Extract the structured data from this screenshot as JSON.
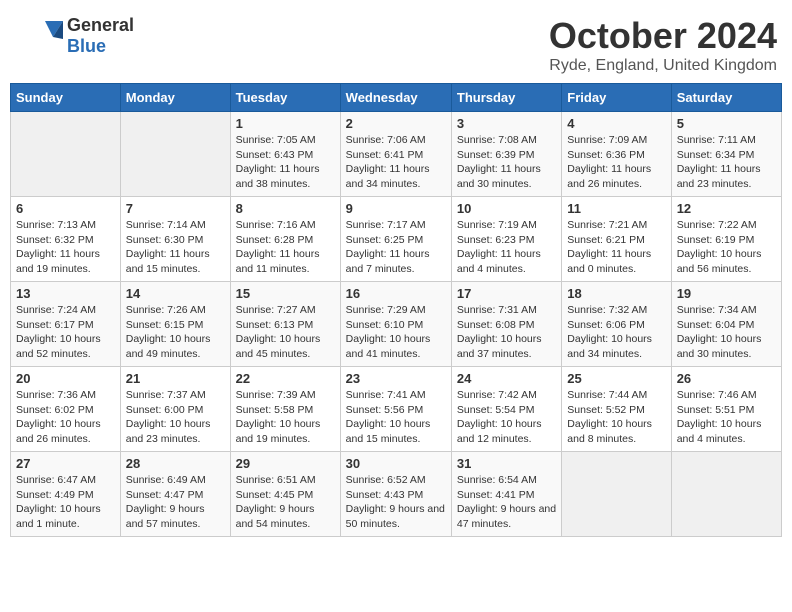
{
  "header": {
    "logo_general": "General",
    "logo_blue": "Blue",
    "month": "October 2024",
    "location": "Ryde, England, United Kingdom"
  },
  "days_of_week": [
    "Sunday",
    "Monday",
    "Tuesday",
    "Wednesday",
    "Thursday",
    "Friday",
    "Saturday"
  ],
  "weeks": [
    [
      {
        "day": "",
        "info": ""
      },
      {
        "day": "",
        "info": ""
      },
      {
        "day": "1",
        "info": "Sunrise: 7:05 AM\nSunset: 6:43 PM\nDaylight: 11 hours and 38 minutes."
      },
      {
        "day": "2",
        "info": "Sunrise: 7:06 AM\nSunset: 6:41 PM\nDaylight: 11 hours and 34 minutes."
      },
      {
        "day": "3",
        "info": "Sunrise: 7:08 AM\nSunset: 6:39 PM\nDaylight: 11 hours and 30 minutes."
      },
      {
        "day": "4",
        "info": "Sunrise: 7:09 AM\nSunset: 6:36 PM\nDaylight: 11 hours and 26 minutes."
      },
      {
        "day": "5",
        "info": "Sunrise: 7:11 AM\nSunset: 6:34 PM\nDaylight: 11 hours and 23 minutes."
      }
    ],
    [
      {
        "day": "6",
        "info": "Sunrise: 7:13 AM\nSunset: 6:32 PM\nDaylight: 11 hours and 19 minutes."
      },
      {
        "day": "7",
        "info": "Sunrise: 7:14 AM\nSunset: 6:30 PM\nDaylight: 11 hours and 15 minutes."
      },
      {
        "day": "8",
        "info": "Sunrise: 7:16 AM\nSunset: 6:28 PM\nDaylight: 11 hours and 11 minutes."
      },
      {
        "day": "9",
        "info": "Sunrise: 7:17 AM\nSunset: 6:25 PM\nDaylight: 11 hours and 7 minutes."
      },
      {
        "day": "10",
        "info": "Sunrise: 7:19 AM\nSunset: 6:23 PM\nDaylight: 11 hours and 4 minutes."
      },
      {
        "day": "11",
        "info": "Sunrise: 7:21 AM\nSunset: 6:21 PM\nDaylight: 11 hours and 0 minutes."
      },
      {
        "day": "12",
        "info": "Sunrise: 7:22 AM\nSunset: 6:19 PM\nDaylight: 10 hours and 56 minutes."
      }
    ],
    [
      {
        "day": "13",
        "info": "Sunrise: 7:24 AM\nSunset: 6:17 PM\nDaylight: 10 hours and 52 minutes."
      },
      {
        "day": "14",
        "info": "Sunrise: 7:26 AM\nSunset: 6:15 PM\nDaylight: 10 hours and 49 minutes."
      },
      {
        "day": "15",
        "info": "Sunrise: 7:27 AM\nSunset: 6:13 PM\nDaylight: 10 hours and 45 minutes."
      },
      {
        "day": "16",
        "info": "Sunrise: 7:29 AM\nSunset: 6:10 PM\nDaylight: 10 hours and 41 minutes."
      },
      {
        "day": "17",
        "info": "Sunrise: 7:31 AM\nSunset: 6:08 PM\nDaylight: 10 hours and 37 minutes."
      },
      {
        "day": "18",
        "info": "Sunrise: 7:32 AM\nSunset: 6:06 PM\nDaylight: 10 hours and 34 minutes."
      },
      {
        "day": "19",
        "info": "Sunrise: 7:34 AM\nSunset: 6:04 PM\nDaylight: 10 hours and 30 minutes."
      }
    ],
    [
      {
        "day": "20",
        "info": "Sunrise: 7:36 AM\nSunset: 6:02 PM\nDaylight: 10 hours and 26 minutes."
      },
      {
        "day": "21",
        "info": "Sunrise: 7:37 AM\nSunset: 6:00 PM\nDaylight: 10 hours and 23 minutes."
      },
      {
        "day": "22",
        "info": "Sunrise: 7:39 AM\nSunset: 5:58 PM\nDaylight: 10 hours and 19 minutes."
      },
      {
        "day": "23",
        "info": "Sunrise: 7:41 AM\nSunset: 5:56 PM\nDaylight: 10 hours and 15 minutes."
      },
      {
        "day": "24",
        "info": "Sunrise: 7:42 AM\nSunset: 5:54 PM\nDaylight: 10 hours and 12 minutes."
      },
      {
        "day": "25",
        "info": "Sunrise: 7:44 AM\nSunset: 5:52 PM\nDaylight: 10 hours and 8 minutes."
      },
      {
        "day": "26",
        "info": "Sunrise: 7:46 AM\nSunset: 5:51 PM\nDaylight: 10 hours and 4 minutes."
      }
    ],
    [
      {
        "day": "27",
        "info": "Sunrise: 6:47 AM\nSunset: 4:49 PM\nDaylight: 10 hours and 1 minute."
      },
      {
        "day": "28",
        "info": "Sunrise: 6:49 AM\nSunset: 4:47 PM\nDaylight: 9 hours and 57 minutes."
      },
      {
        "day": "29",
        "info": "Sunrise: 6:51 AM\nSunset: 4:45 PM\nDaylight: 9 hours and 54 minutes."
      },
      {
        "day": "30",
        "info": "Sunrise: 6:52 AM\nSunset: 4:43 PM\nDaylight: 9 hours and 50 minutes."
      },
      {
        "day": "31",
        "info": "Sunrise: 6:54 AM\nSunset: 4:41 PM\nDaylight: 9 hours and 47 minutes."
      },
      {
        "day": "",
        "info": ""
      },
      {
        "day": "",
        "info": ""
      }
    ]
  ]
}
